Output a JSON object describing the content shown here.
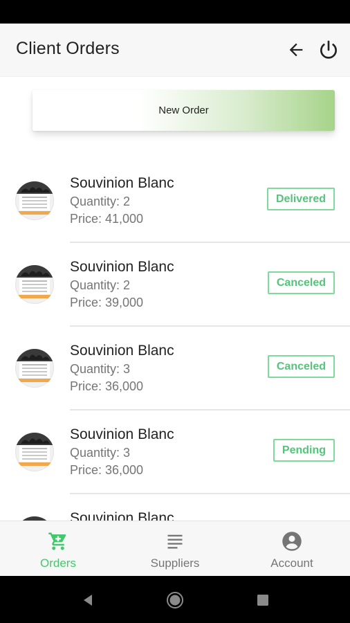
{
  "app_bar": {
    "title": "Client Orders"
  },
  "actions": {
    "new_order_label": "New Order"
  },
  "orders": [
    {
      "name": "Souvinion Blanc",
      "quantity": "Quantity: 2",
      "price": "Price: 41,000",
      "status": "Delivered"
    },
    {
      "name": "Souvinion Blanc",
      "quantity": "Quantity: 2",
      "price": "Price: 39,000",
      "status": "Canceled"
    },
    {
      "name": "Souvinion Blanc",
      "quantity": "Quantity: 3",
      "price": "Price: 36,000",
      "status": "Canceled"
    },
    {
      "name": "Souvinion Blanc",
      "quantity": "Quantity: 3",
      "price": "Price: 36,000",
      "status": "Pending"
    },
    {
      "name": "Souvinion Blanc",
      "quantity": "",
      "price": "",
      "status": ""
    }
  ],
  "bottom_nav": {
    "items": [
      {
        "label": "Orders",
        "icon": "cart-icon",
        "active": true
      },
      {
        "label": "Suppliers",
        "icon": "list-icon",
        "active": false
      },
      {
        "label": "Account",
        "icon": "account-icon",
        "active": false
      }
    ]
  },
  "colors": {
    "accent": "#45c76d",
    "badge_border": "#7ed99a",
    "new_order_gradient_end": "#a6d38a"
  }
}
